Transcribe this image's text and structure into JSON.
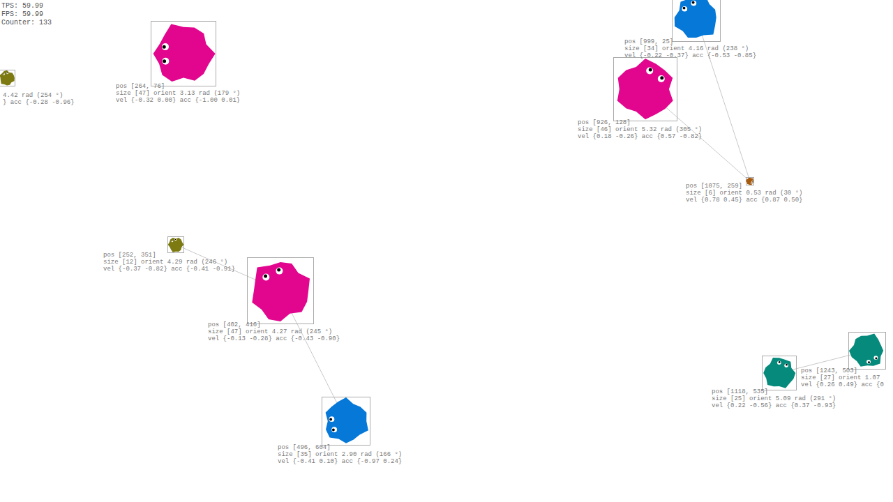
{
  "hud": [
    "TPS: 59.99",
    "FPS: 59.99",
    "Counter: 133"
  ],
  "creatures": [
    {
      "color": "#7d7a12",
      "lines": [
        "4.42 rad (254 °)",
        "} acc {-0.28 -0.96}"
      ]
    },
    {
      "color": "#e2068f",
      "lines": [
        "pos [264, 76]",
        "size [47] orient 3.13 rad (179 °)",
        "vel {-0.32 0.00} acc {-1.00 0.01}"
      ]
    },
    {
      "color": "#0578d8",
      "lines": [
        "pos [999, 25]",
        "size [34] orient 4.16 rad (238 °)",
        "vel {-0.22 -0.37} acc {-0.53 -0.85}"
      ]
    },
    {
      "color": "#e2068f",
      "lines": [
        "pos [926, 128]",
        "size [46] orient 5.32 rad (305 °)",
        "vel {0.18 -0.26} acc {0.57 -0.82}"
      ]
    },
    {
      "color": "#a85a0a",
      "lines": [
        "pos [1075, 259]",
        "size [6] orient 0.53 rad (30 °)",
        "vel {0.78 0.45} acc {0.87 0.50}"
      ]
    },
    {
      "color": "#7d7a12",
      "lines": [
        "pos [252, 351]",
        "size [12] orient 4.29 rad (246 °)",
        "vel {-0.37 -0.82} acc {-0.41 -0.91}"
      ]
    },
    {
      "color": "#e2068f",
      "lines": [
        "pos [402, 416]",
        "size [47] orient 4.27 rad (245 °)",
        "vel {-0.13 -0.28} acc {-0.43 -0.90}"
      ]
    },
    {
      "color": "#0578d8",
      "lines": [
        "pos [496, 604]",
        "size [35] orient 2.90 rad (166 °)",
        "vel {-0.41 0.10} acc {-0.97 0.24}"
      ]
    },
    {
      "color": "#058a7c",
      "lines": [
        "pos [1118, 535]",
        "size [25] orient 5.09 rad (291 °)",
        "vel {0.22 -0.56} acc {0.37 -0.93}"
      ]
    },
    {
      "color": "#058a7c",
      "lines": [
        "pos [1243, 503]",
        "size [27] orient 1.07",
        "vel {0.26 0.49} acc {0"
      ]
    }
  ],
  "links": [
    [
      5,
      6
    ],
    [
      6,
      7
    ],
    [
      2,
      4
    ],
    [
      3,
      4
    ],
    [
      8,
      9
    ]
  ]
}
